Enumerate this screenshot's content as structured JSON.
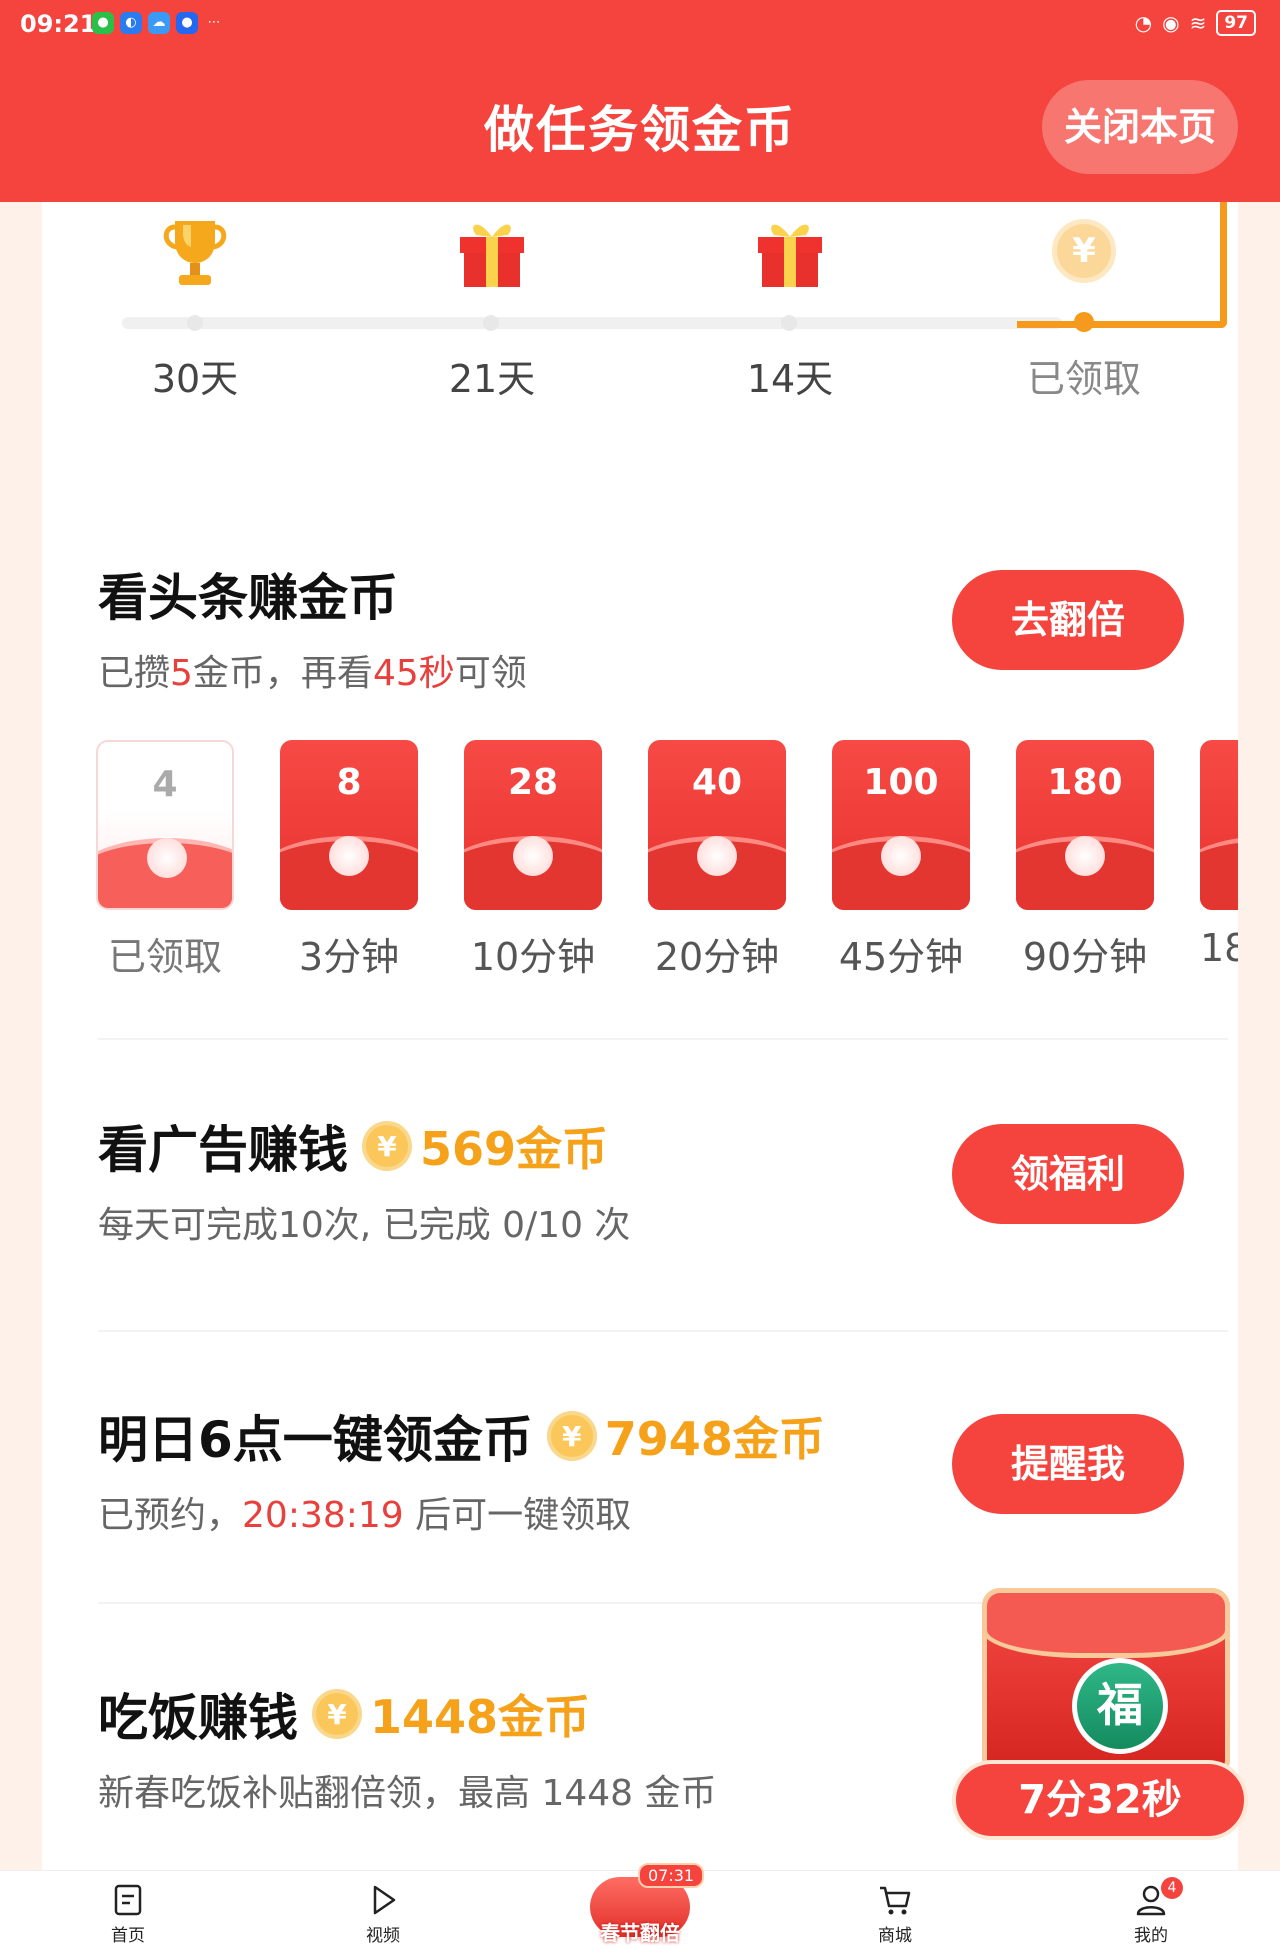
{
  "status_bar": {
    "time": "09:21",
    "battery": "97"
  },
  "header": {
    "title": "做任务领金币",
    "close_label": "关闭本页"
  },
  "milestones": [
    {
      "label": "30天",
      "icon": "trophy-icon"
    },
    {
      "label": "21天",
      "icon": "gift-icon"
    },
    {
      "label": "14天",
      "icon": "gift-icon"
    },
    {
      "label": "已领取",
      "icon": "coin-icon",
      "coin_symbol": "¥"
    }
  ],
  "news_task": {
    "title": "看头条赚金币",
    "sub_prefix": "已攒",
    "sub_coins": "5",
    "sub_mid": "金币，再看",
    "sub_seconds": "45秒",
    "sub_suffix": "可领",
    "button": "去翻倍",
    "envelopes": [
      {
        "amount": "4",
        "caption": "已领取",
        "claimed": true
      },
      {
        "amount": "8",
        "caption": "3分钟"
      },
      {
        "amount": "28",
        "caption": "10分钟"
      },
      {
        "amount": "40",
        "caption": "20分钟"
      },
      {
        "amount": "100",
        "caption": "45分钟"
      },
      {
        "amount": "180",
        "caption": "90分钟"
      },
      {
        "amount": "",
        "caption": "18"
      }
    ]
  },
  "ad_task": {
    "title": "看广告赚钱",
    "coin_symbol": "¥",
    "coins": "569金币",
    "sub": "每天可完成10次, 已完成 0/10 次",
    "button": "领福利"
  },
  "tomorrow_task": {
    "title": "明日6点一键领金币",
    "coin_symbol": "¥",
    "coins": "7948金币",
    "sub_prefix": "已预约，",
    "countdown": "20:38:19",
    "sub_suffix": " 后可一键领取",
    "button": "提醒我"
  },
  "meal_task": {
    "title": "吃饭赚钱",
    "coin_symbol": "¥",
    "coins": "1448金币",
    "sub": "新春吃饭补贴翻倍领，最高 1448 金币"
  },
  "float_badge": {
    "symbol": "福",
    "timer": "7分32秒"
  },
  "bottom_nav": {
    "home": "首页",
    "video": "视频",
    "center_time": "07:31",
    "center_label": "春节翻倍",
    "mall": "商城",
    "mine": "我的",
    "mine_badge": "4"
  },
  "colors": {
    "brand_red": "#f5433e",
    "coin_gold": "#f5a11a",
    "progress_orange": "#f59a1c"
  }
}
